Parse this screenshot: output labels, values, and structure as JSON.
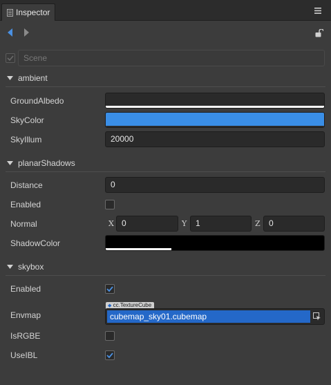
{
  "panel": {
    "tab_label": "Inspector"
  },
  "node": {
    "name": "Scene",
    "enabled": false
  },
  "sections": {
    "ambient": {
      "label": "ambient",
      "props": {
        "ground_albedo": {
          "label": "GroundAlbedo",
          "color": "#ffffff"
        },
        "sky_color": {
          "label": "SkyColor",
          "color": "#3a8ee6"
        },
        "sky_illum": {
          "label": "SkyIllum",
          "value": "20000"
        }
      }
    },
    "planar_shadows": {
      "label": "planarShadows",
      "props": {
        "distance": {
          "label": "Distance",
          "value": "0"
        },
        "enabled": {
          "label": "Enabled",
          "checked": false
        },
        "normal": {
          "label": "Normal",
          "x_label": "X",
          "x": "0",
          "y_label": "Y",
          "y": "1",
          "z_label": "Z",
          "z": "0"
        },
        "shadow_color": {
          "label": "ShadowColor",
          "color": "#000000",
          "alpha": 0.3
        }
      }
    },
    "skybox": {
      "label": "skybox",
      "props": {
        "enabled": {
          "label": "Enabled",
          "checked": true
        },
        "envmap": {
          "label": "Envmap",
          "type_tag": "cc.TextureCube",
          "value": "cubemap_sky01.cubemap"
        },
        "is_rgbe": {
          "label": "IsRGBE",
          "checked": false
        },
        "use_ibl": {
          "label": "UseIBL",
          "checked": true
        }
      }
    }
  },
  "colors": {
    "accent": "#4a90e2",
    "asset_highlight": "#2468c8"
  },
  "icons": [
    "inspector-icon",
    "menu-icon",
    "back-arrow-icon",
    "forward-arrow-icon",
    "unlock-icon",
    "eyedropper-icon"
  ]
}
